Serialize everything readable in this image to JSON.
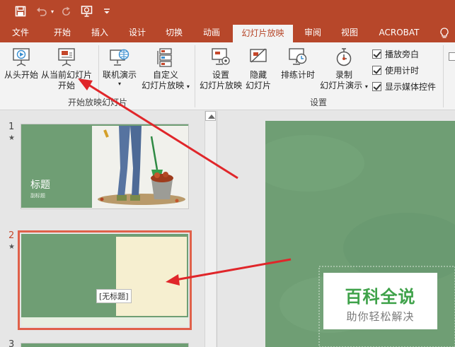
{
  "colors": {
    "accent": "#b7472a",
    "ribbon_bg": "#f3f3f3",
    "slide_green": "#6f9e74",
    "slide_cream": "#f6efd0",
    "selection": "#e0614a",
    "annotation_red": "#e0262a",
    "watermark_green": "#3fa24a"
  },
  "quick_access": {
    "icons": [
      "save-icon",
      "undo-icon",
      "redo-icon",
      "start-from-beginning-icon",
      "customize-qat-icon"
    ]
  },
  "tabs": [
    {
      "label": "文件"
    },
    {
      "label": "开始"
    },
    {
      "label": "插入"
    },
    {
      "label": "设计"
    },
    {
      "label": "切换"
    },
    {
      "label": "动画"
    },
    {
      "label": "幻灯片放映",
      "active": true
    },
    {
      "label": "审阅"
    },
    {
      "label": "视图"
    },
    {
      "label": "ACROBAT"
    }
  ],
  "tell_me_icon": "lightbulb-icon",
  "ribbon": {
    "group_start": {
      "label": "开始放映幻灯片",
      "from_beginning": "从头开始",
      "from_current_line1": "从当前幻灯片",
      "from_current_line2": "开始",
      "online_present": "联机演示",
      "custom_line1": "自定义",
      "custom_line2": "幻灯片放映"
    },
    "group_setup": {
      "label": "设置",
      "setup_line1": "设置",
      "setup_line2": "幻灯片放映",
      "hide_line1": "隐藏",
      "hide_line2": "幻灯片",
      "rehearse": "排练计时",
      "record_line1": "录制",
      "record_line2": "幻灯片演示",
      "checkboxes": [
        {
          "label": "播放旁白",
          "checked": true
        },
        {
          "label": "使用计时",
          "checked": true
        },
        {
          "label": "显示媒体控件",
          "checked": true
        }
      ]
    }
  },
  "slides": [
    {
      "number": "1",
      "title": "标题",
      "subtitle": "副标题",
      "selected": false
    },
    {
      "number": "2",
      "placeholder": "[无标题]",
      "selected": true
    },
    {
      "number": "3"
    }
  ],
  "watermark": {
    "line1": "百科全说",
    "line2": "助你轻松解决"
  }
}
